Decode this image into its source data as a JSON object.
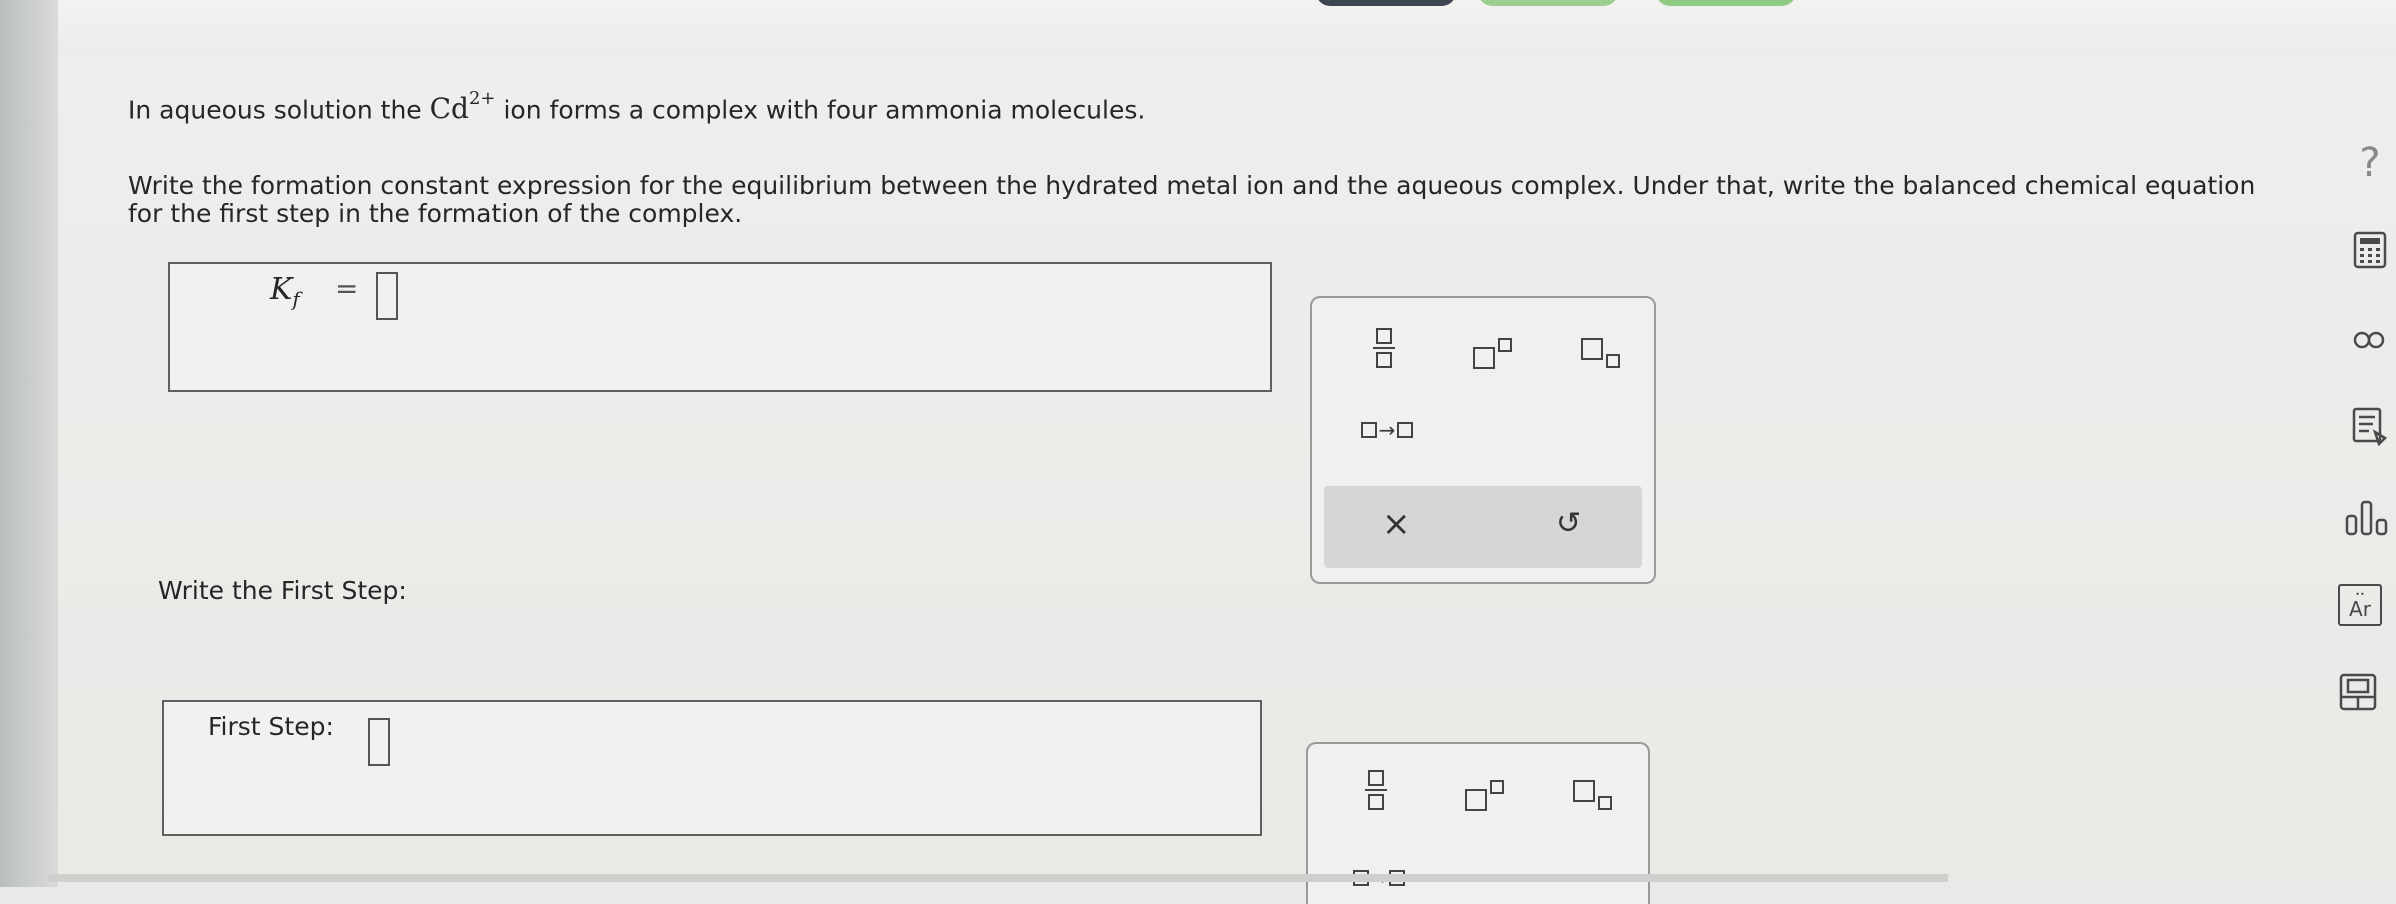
{
  "question": {
    "line1_before": "In aqueous solution the",
    "ion_symbol": "Cd",
    "ion_charge": "2+",
    "line1_after": "ion forms a complex with four ammonia molecules.",
    "line2": "Write the formation constant expression for the equilibrium between the hydrated metal ion and the aqueous complex. Under that, write the balanced chemical equation for the first step in the formation of the complex."
  },
  "kf_box": {
    "label_main": "K",
    "label_sub": "f",
    "equals": "="
  },
  "first_step": {
    "heading": "Write the First Step:",
    "box_label": "First Step:"
  },
  "palette": {
    "arrow": "→",
    "clear_symbol": "×",
    "undo_symbol": "↺"
  },
  "sidebar": {
    "help_symbol": "?",
    "periodic_label": "Ar"
  }
}
